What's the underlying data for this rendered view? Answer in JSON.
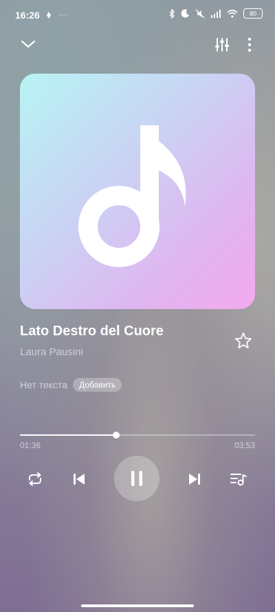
{
  "status_bar": {
    "time": "16:26",
    "extra": "···",
    "battery": "80"
  },
  "track": {
    "title": "Lato Destro del Cuore",
    "artist": "Laura Pausini"
  },
  "lyrics": {
    "no_lyrics_label": "Нет текста",
    "add_button_label": "Добавить"
  },
  "playback": {
    "current_time": "01:36",
    "total_time": "03:53",
    "progress": 0.41
  },
  "icons": {
    "collapse": "chevron-down-icon",
    "equalizer": "equalizer-icon",
    "more": "more-vert-icon",
    "favorite": "star-icon",
    "repeat": "repeat-icon",
    "previous": "skip-previous-icon",
    "pause": "pause-icon",
    "next": "skip-next-icon",
    "queue": "playlist-icon",
    "cover": "music-note-icon"
  }
}
